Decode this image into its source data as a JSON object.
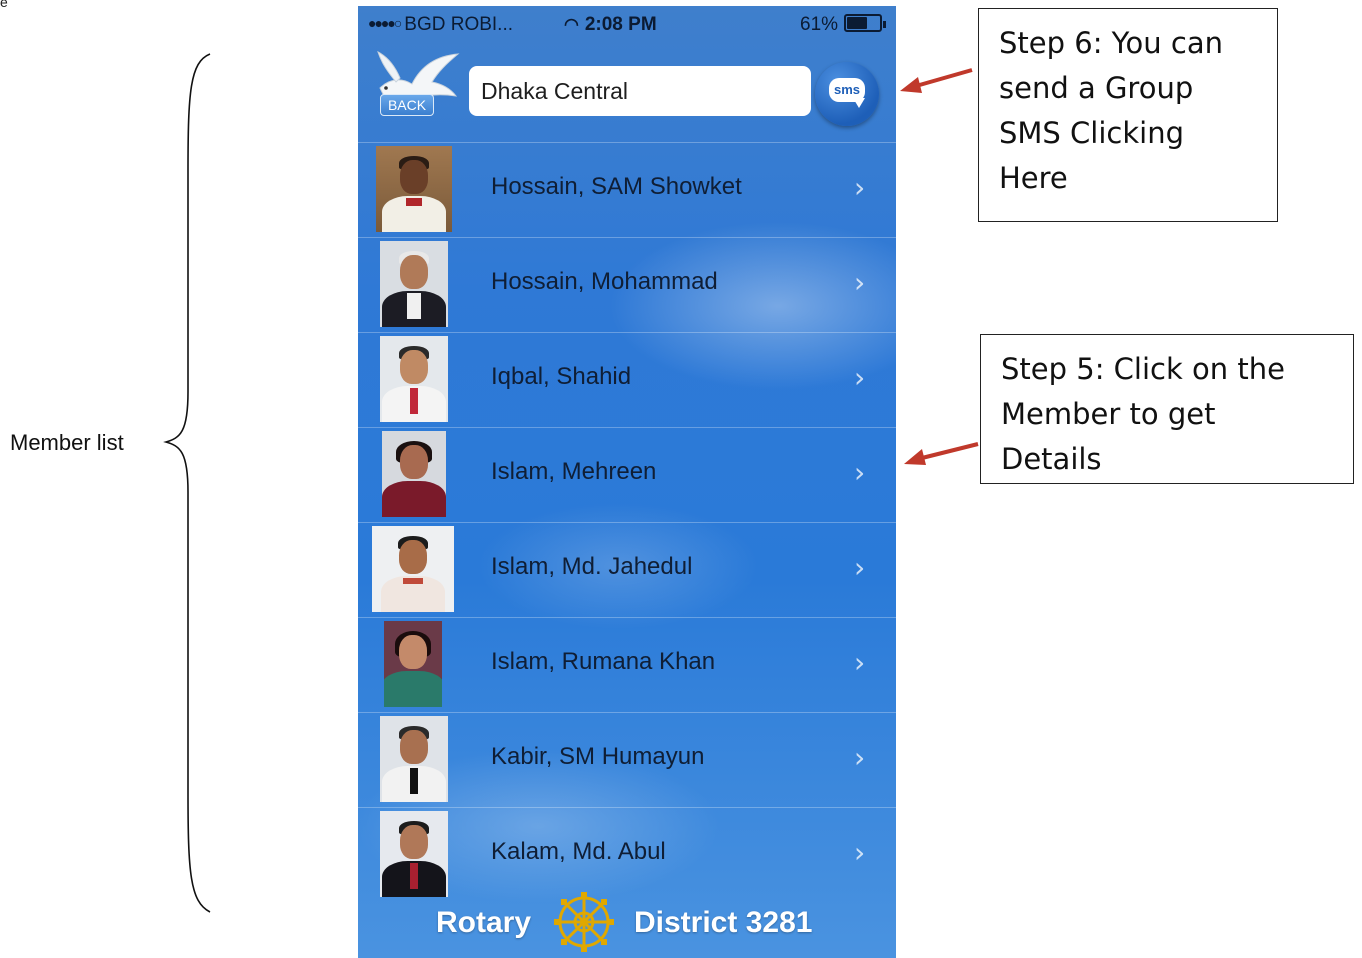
{
  "annotation": {
    "member_list_label": "Member list",
    "corner_mark": "e"
  },
  "status_bar": {
    "carrier": "BGD ROBI...",
    "signal_dots": "●●●●○",
    "time": "2:08 PM",
    "battery_percent": "61%",
    "battery_level": 0.61
  },
  "header": {
    "back_label": "BACK",
    "club_name": "Dhaka Central",
    "sms_label": "sms"
  },
  "members": [
    {
      "name": "Hossain, SAM Showket"
    },
    {
      "name": "Hossain, Mohammad"
    },
    {
      "name": "Iqbal, Shahid"
    },
    {
      "name": "Islam, Mehreen"
    },
    {
      "name": "Islam, Md. Jahedul"
    },
    {
      "name": "Islam, Rumana Khan"
    },
    {
      "name": "Kabir, SM Humayun"
    },
    {
      "name": "Kalam, Md. Abul"
    }
  ],
  "footer": {
    "left": "Rotary",
    "right": "District 3281"
  },
  "callouts": {
    "step6": [
      "Step 6: You can",
      "send a Group",
      "SMS Clicking",
      "Here"
    ],
    "step5": [
      "Step 5: Click on the",
      "Member to get",
      "Details"
    ]
  },
  "colors": {
    "arrow": "#c0392b",
    "rotary_gold": "#e0a800",
    "sky_blue": "#2f79d6"
  },
  "icons": {
    "chevron": "›",
    "wifi": "wifi-icon",
    "dove": "dove-icon"
  }
}
